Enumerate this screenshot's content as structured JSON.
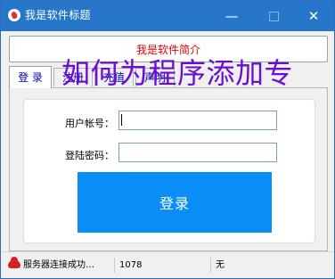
{
  "window": {
    "title": "我是软件标题"
  },
  "controls": {
    "minimize": "—",
    "close": "✕"
  },
  "intro": "我是软件简介",
  "tabs": [
    "登 录",
    "注册",
    "充值",
    "声明"
  ],
  "watermark": "如何为程序添加专",
  "login": {
    "account_label": "用户帐号：",
    "password_label": "登陆密码：",
    "button_label": "登录"
  },
  "status": {
    "message": "服务器连接成功…",
    "count": "1078",
    "extra": "无"
  },
  "colors": {
    "title_bar": "#2677c9",
    "intro_text": "#e00000",
    "button": "#0a8ef5",
    "watermark": "#6a0fd1"
  }
}
